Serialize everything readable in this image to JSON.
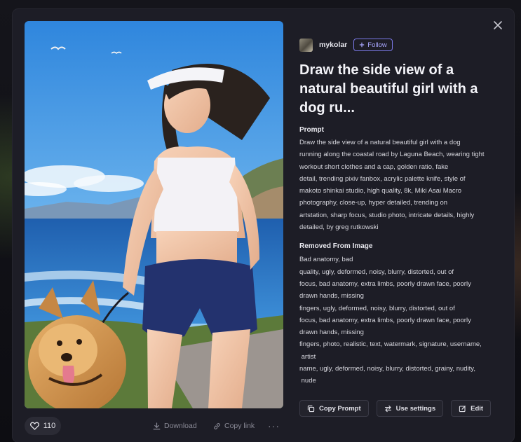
{
  "author": {
    "name": "mykolar",
    "follow_label": "Follow"
  },
  "title": "Draw the side view of a natural beautiful girl with a dog ru...",
  "prompt": {
    "label": "Prompt",
    "lines": [
      "Draw the side view of a natural beautiful girl with a dog",
      "running along the coastal road by Laguna Beach, wearing tight",
      "workout short clothes and a cap, golden ratio, fake",
      "detail, trending pixiv fanbox, acrylic palette knife, style of",
      "makoto shinkai studio, high quality, 8k, Miki Asai Macro",
      "photography, close-up, hyper detailed, trending on",
      "artstation, sharp focus, studio photo, intricate details, highly",
      "detailed, by greg rutkowski"
    ]
  },
  "removed": {
    "label": "Removed From Image",
    "lines": [
      "Bad anatomy, bad",
      "quality, ugly, deformed, noisy, blurry, distorted, out of",
      "focus, bad anatomy, extra limbs, poorly drawn face, poorly",
      "drawn hands, missing",
      "fingers, ugly, deformed, noisy, blurry, distorted, out of",
      "focus, bad anatomy, extra limbs, poorly drawn face, poorly",
      "drawn hands, missing",
      "fingers, photo, realistic, text, watermark, signature, username,",
      " artist",
      "name, ugly, deformed, noisy, blurry, distorted, grainy, nudity,",
      " nude"
    ]
  },
  "actions": {
    "copy_prompt": "Copy Prompt",
    "use_settings": "Use settings",
    "edit": "Edit"
  },
  "bottom": {
    "likes": "110",
    "download": "Download",
    "copy_link": "Copy link",
    "more": "···"
  },
  "colors": {
    "accent": "#7b79e8",
    "modal_bg": "#1d1d26"
  },
  "icons": {
    "close": "close-icon",
    "heart": "heart-icon",
    "download": "download-icon",
    "link": "link-icon",
    "copy": "copy-icon",
    "swap": "swap-icon",
    "edit": "edit-icon",
    "plus": "plus-icon"
  }
}
